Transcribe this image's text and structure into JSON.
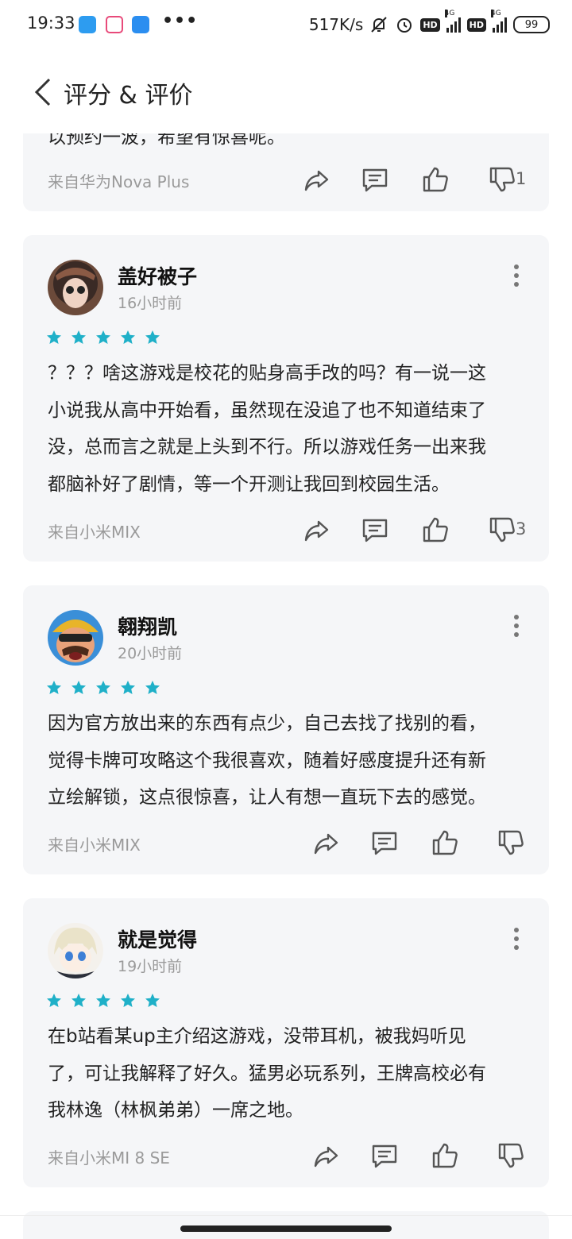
{
  "status_bar": {
    "time": "19:33",
    "dots": "•••",
    "speed": "517K/s",
    "hd": "HD",
    "network": "4G",
    "battery": "99",
    "icons": [
      "mute-bell-icon",
      "alarm-icon",
      "hd-icon",
      "signal-icon",
      "battery-icon"
    ]
  },
  "header": {
    "title": "评分 & 评价"
  },
  "colors": {
    "accent": "#1fb0c8",
    "card_bg": "#f5f6f8",
    "muted": "#9a9a9a"
  },
  "reviews": [
    {
      "partial_text": "以预约一波，希望有惊喜呢。",
      "device": "来自华为Nova Plus",
      "dislike_count": "1"
    },
    {
      "username": "盖好被子",
      "time": "16小时前",
      "rating": 5,
      "lines": [
        "？？？啥这游戏是校花的贴身高手改的吗？有一说一这",
        "小说我从高中开始看，虽然现在没追了也不知道结束了",
        "没，总而言之就是上头到不行。所以游戏任务一出来我",
        "都脑补好了剧情，等一个开测让我回到校园生活。"
      ],
      "device": "来自小米MIX",
      "dislike_count": "3"
    },
    {
      "username": "翱翔凯",
      "time": "20小时前",
      "rating": 5,
      "lines": [
        "因为官方放出来的东西有点少，自己去找了找别的看，",
        "觉得卡牌可攻略这个我很喜欢，随着好感度提升还有新",
        "立绘解锁，这点很惊喜，让人有想一直玩下去的感觉。"
      ],
      "device": "来自小米MIX",
      "dislike_count": ""
    },
    {
      "username": "就是觉得",
      "time": "19小时前",
      "rating": 5,
      "lines": [
        "在b站看某up主介绍这游戏，没带耳机，被我妈听见",
        "了，可让我解释了好久。猛男必玩系列，王牌高校必有",
        "我林逸（林枫弟弟）一席之地。"
      ],
      "device": "来自小米MI 8 SE",
      "dislike_count": ""
    }
  ]
}
